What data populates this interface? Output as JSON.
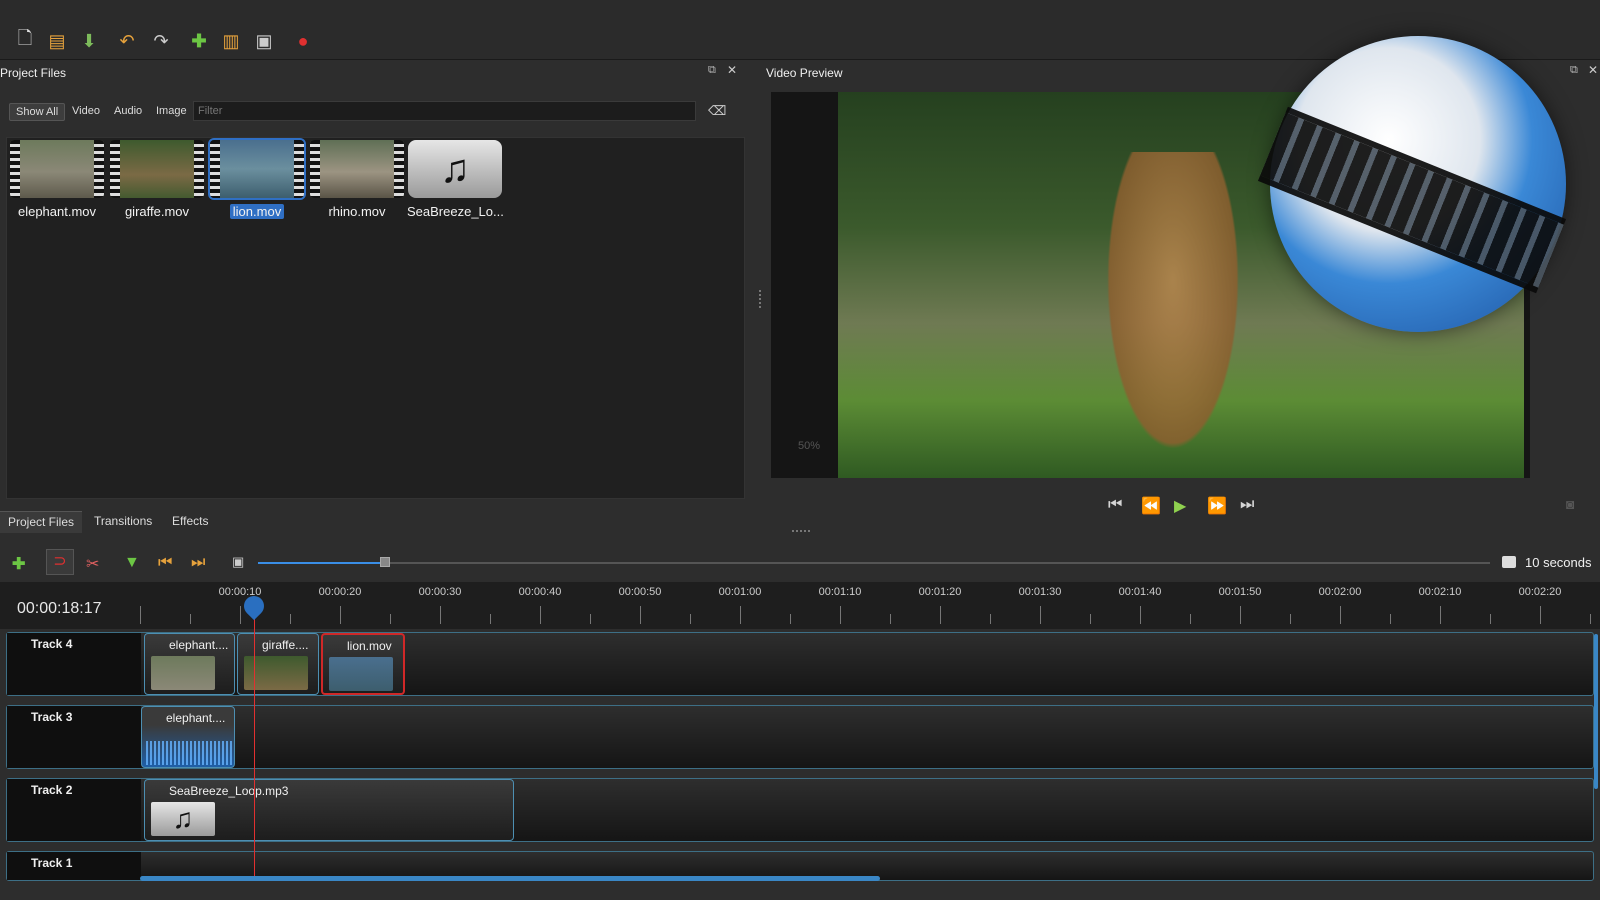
{
  "toolbar": {
    "icons": [
      "new-project-icon",
      "open-project-icon",
      "save-project-icon",
      "undo-icon",
      "redo-icon",
      "import-files-icon",
      "profile-icon",
      "fullscreen-icon",
      "export-icon"
    ]
  },
  "project_files": {
    "title": "Project Files",
    "filter_tabs": [
      "Show All",
      "Video",
      "Audio",
      "Image"
    ],
    "filter_placeholder": "Filter",
    "files": [
      {
        "name": "elephant.mov",
        "selected": false
      },
      {
        "name": "giraffe.mov",
        "selected": false
      },
      {
        "name": "lion.mov",
        "selected": true
      },
      {
        "name": "rhino.mov",
        "selected": false
      },
      {
        "name": "SeaBreeze_Lo...",
        "selected": false
      }
    ]
  },
  "video_preview": {
    "title": "Video Preview",
    "zoom": "50%"
  },
  "bottom_tabs": [
    "Project Files",
    "Transitions",
    "Effects"
  ],
  "timeline": {
    "zoom_label": "10 seconds",
    "zoom_fraction": 0.1,
    "timecode": "00:00:18:17",
    "ruler_labels": [
      "00:00:10",
      "00:00:20",
      "00:00:30",
      "00:00:40",
      "00:00:50",
      "00:01:00",
      "00:01:10",
      "00:01:20",
      "00:01:30",
      "00:01:40",
      "00:01:50",
      "00:02:00",
      "00:02:10",
      "00:02:20"
    ],
    "tracks": [
      {
        "name": "Track 4",
        "clips": [
          {
            "title": "elephant....",
            "kind": "video",
            "selected": false
          },
          {
            "title": "giraffe....",
            "kind": "video",
            "selected": false
          },
          {
            "title": "lion.mov",
            "kind": "video",
            "selected": true
          }
        ]
      },
      {
        "name": "Track 3",
        "clips": [
          {
            "title": "elephant....",
            "kind": "waveform",
            "selected": false
          }
        ]
      },
      {
        "name": "Track 2",
        "clips": [
          {
            "title": "SeaBreeze_Loop.mp3",
            "kind": "audio",
            "selected": false
          }
        ]
      },
      {
        "name": "Track 1",
        "clips": []
      }
    ]
  },
  "colors": {
    "accent": "#2f6fc4",
    "selected_clip_border": "#d02828",
    "playhead": "#e23030",
    "track_border": "#3d6f86"
  }
}
